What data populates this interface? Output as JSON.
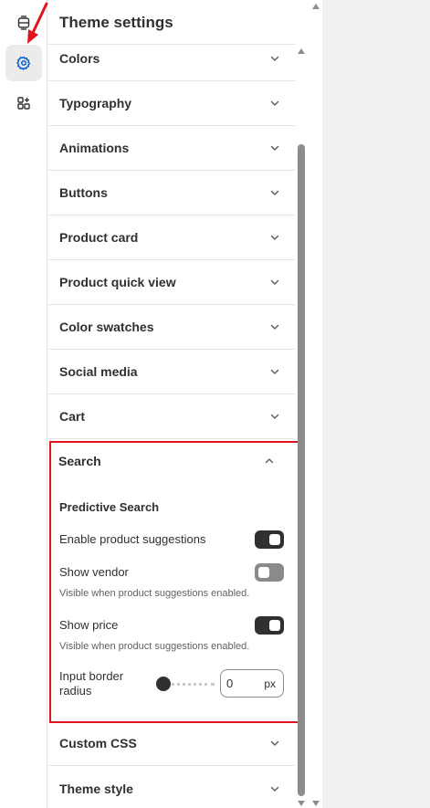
{
  "rail": {
    "items": [
      {
        "name": "sections-icon",
        "active": false
      },
      {
        "name": "gear-icon",
        "active": true
      },
      {
        "name": "apps-icon",
        "active": false
      }
    ]
  },
  "panel": {
    "title": "Theme settings",
    "sections_top": [
      {
        "label": "Colors"
      },
      {
        "label": "Typography"
      },
      {
        "label": "Animations"
      },
      {
        "label": "Buttons"
      },
      {
        "label": "Product card"
      },
      {
        "label": "Product quick view"
      },
      {
        "label": "Color swatches"
      },
      {
        "label": "Social media"
      },
      {
        "label": "Cart"
      }
    ],
    "search": {
      "label": "Search",
      "expanded": true,
      "subheading": "Predictive Search",
      "enable_suggestions": {
        "label": "Enable product suggestions",
        "on": true
      },
      "show_vendor": {
        "label": "Show vendor",
        "on": false,
        "hint": "Visible when product suggestions enabled."
      },
      "show_price": {
        "label": "Show price",
        "on": true,
        "hint": "Visible when product suggestions enabled."
      },
      "border_radius": {
        "label_line1": "Input border",
        "label_line2": "radius",
        "value": "0",
        "unit": "px"
      }
    },
    "sections_bottom": [
      {
        "label": "Custom CSS"
      },
      {
        "label": "Theme style"
      }
    ]
  },
  "colors": {
    "highlight": "#e0141e",
    "active_icon": "#005bd3",
    "toggle_on": "#303030",
    "toggle_off": "#8a8a8a"
  }
}
